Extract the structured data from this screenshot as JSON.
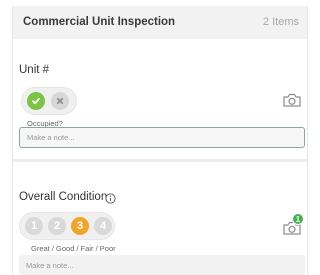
{
  "header": {
    "title": "Commercial Unit Inspection",
    "count": "2 Items"
  },
  "unit": {
    "label": "Unit #",
    "toggle_caption": "Occupied?",
    "note_placeholder": "Make a note..."
  },
  "condition": {
    "label": "Overall Condition",
    "ratings": [
      "1",
      "2",
      "3",
      "4"
    ],
    "selected": "3",
    "rating_caption": "Great / Good / Fair / Poor",
    "photo_count": "1",
    "note_placeholder": "Make a note..."
  },
  "colors": {
    "yes": "#7cc443",
    "selected_rating": "#f3a52a",
    "badge": "#3fb44b"
  }
}
